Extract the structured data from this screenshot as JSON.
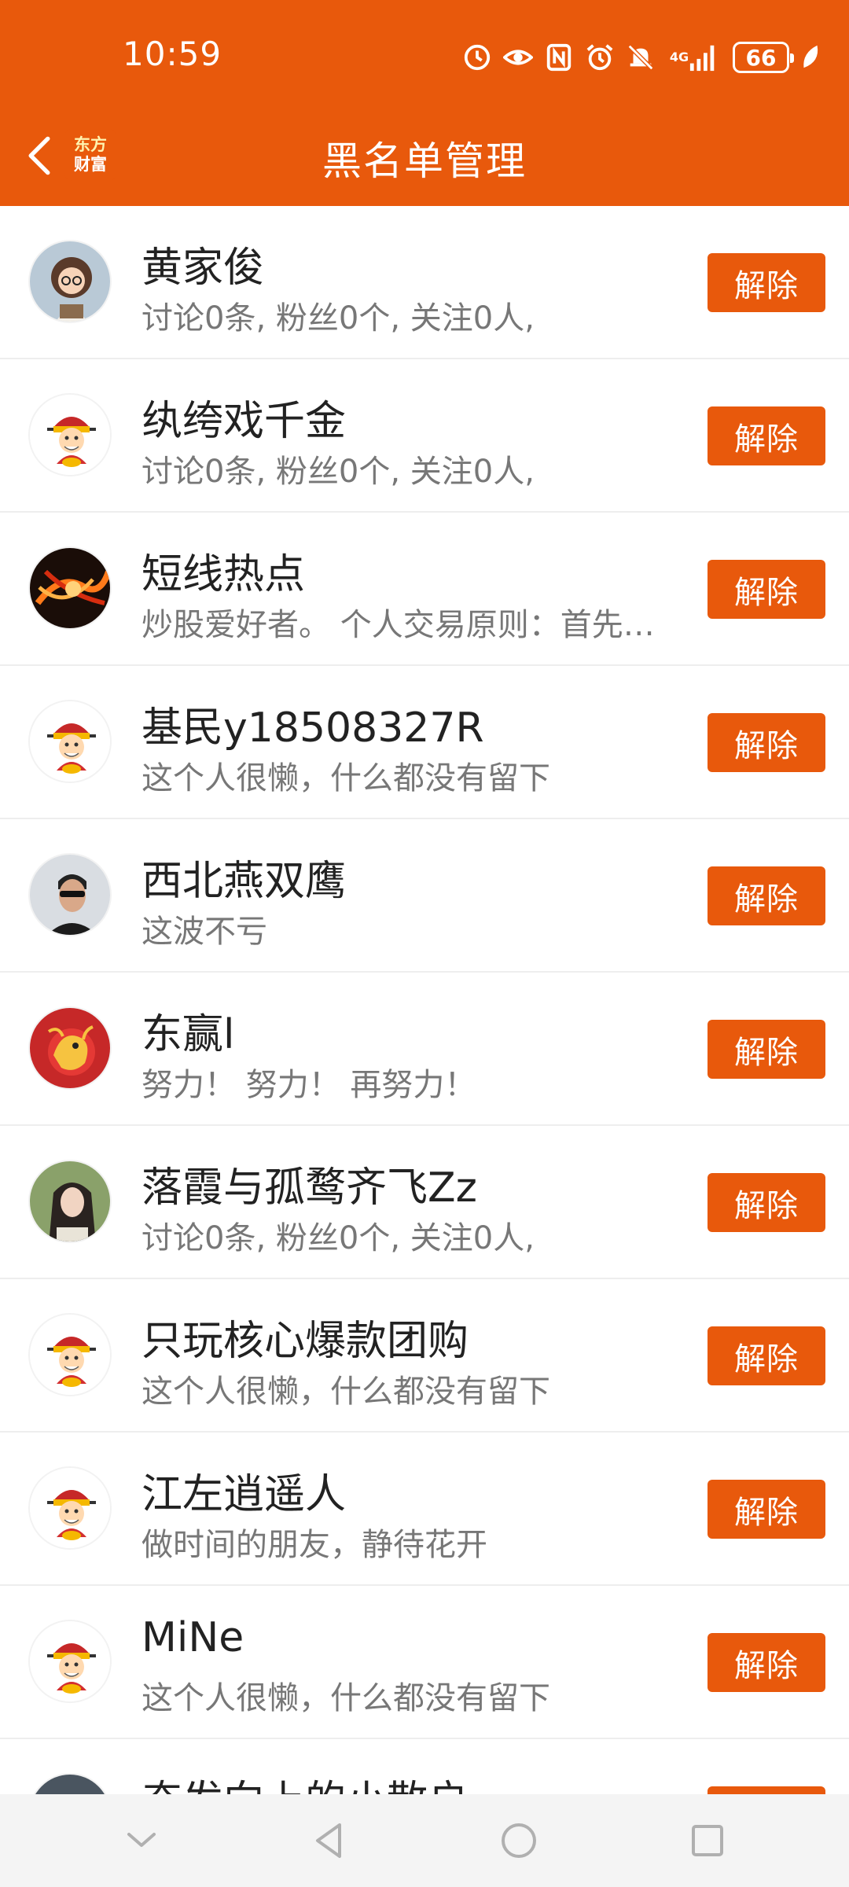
{
  "status_bar": {
    "time": "10:59",
    "network": "4G",
    "battery": "66",
    "icons": [
      "clock-badge-icon",
      "eye-icon",
      "nfc-icon",
      "alarm-icon",
      "mute-icon",
      "signal-icon",
      "battery-icon",
      "leaf-icon"
    ]
  },
  "header": {
    "back_icon": "chevron-left-icon",
    "logo_line1": "东方",
    "logo_line2": "财富",
    "title": "黑名单管理"
  },
  "colors": {
    "accent": "#e8590c",
    "text_primary": "#222222",
    "text_secondary": "#777777",
    "divider": "#eeeeee"
  },
  "button_label": "解除",
  "users": [
    {
      "name": "黄家俊",
      "desc": "讨论0条, 粉丝0个, 关注0人,",
      "avatar": "cartoon-girl-reading",
      "remove_label": "解除"
    },
    {
      "name": "纨绔戏千金",
      "desc": "讨论0条, 粉丝0个, 关注0人,",
      "avatar": "god-of-wealth-default",
      "remove_label": "解除"
    },
    {
      "name": "短线热点",
      "desc": "炒股爱好者。 个人交易原则：首先要...",
      "avatar": "fire-swirl",
      "remove_label": "解除"
    },
    {
      "name": "基民y18508327R",
      "desc": "这个人很懒，什么都没有留下",
      "avatar": "god-of-wealth-default",
      "remove_label": "解除"
    },
    {
      "name": "西北燕双鹰",
      "desc": "这波不亏",
      "avatar": "man-sunglasses",
      "remove_label": "解除"
    },
    {
      "name": "东赢l",
      "desc": "努力！ 努力！ 再努力！",
      "avatar": "red-dragon",
      "remove_label": "解除"
    },
    {
      "name": "落霞与孤鹜齐飞Zz",
      "desc": "讨论0条, 粉丝0个, 关注0人,",
      "avatar": "girl-long-hair",
      "remove_label": "解除"
    },
    {
      "name": "只玩核心爆款团购",
      "desc": "这个人很懒，什么都没有留下",
      "avatar": "god-of-wealth-default",
      "remove_label": "解除"
    },
    {
      "name": "江左逍遥人",
      "desc": "做时间的朋友，静待花开",
      "avatar": "god-of-wealth-default",
      "remove_label": "解除"
    },
    {
      "name": "MiNe",
      "desc": "这个人很懒，什么都没有留下",
      "avatar": "god-of-wealth-default",
      "remove_label": "解除"
    },
    {
      "name": "奋发向上的小散户",
      "desc": "",
      "avatar": "dark-photo",
      "remove_label": "解除"
    }
  ],
  "system_nav": [
    "collapse-chevron-icon",
    "back-triangle-icon",
    "home-circle-icon",
    "recents-square-icon"
  ]
}
